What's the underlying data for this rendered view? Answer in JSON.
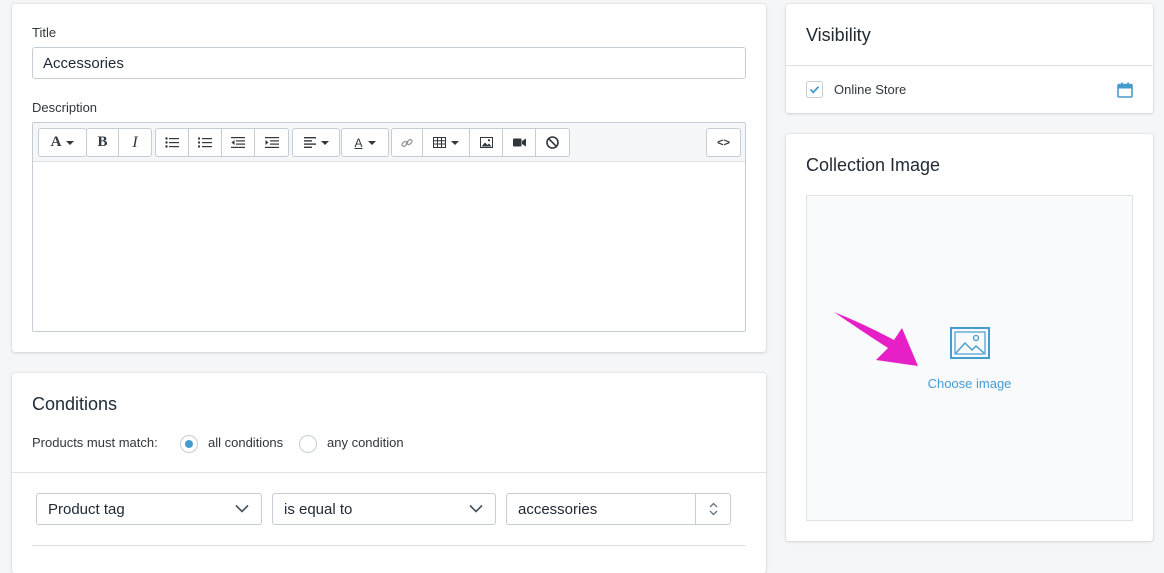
{
  "title_field": {
    "label": "Title",
    "value": "Accessories"
  },
  "description": {
    "label": "Description",
    "toolbar": [
      {
        "icon": "font-icon",
        "text": "A"
      },
      {
        "icon": "bold-icon",
        "text": "B"
      },
      {
        "icon": "italic-icon",
        "text": "I"
      },
      {
        "icon": "bulleted-list-icon"
      },
      {
        "icon": "numbered-list-icon"
      },
      {
        "icon": "outdent-icon"
      },
      {
        "icon": "indent-icon"
      },
      {
        "icon": "align-icon"
      },
      {
        "icon": "text-color-icon",
        "text": "A"
      },
      {
        "icon": "link-icon"
      },
      {
        "icon": "table-icon"
      },
      {
        "icon": "image-icon"
      },
      {
        "icon": "video-icon"
      },
      {
        "icon": "clear-format-icon"
      },
      {
        "icon": "code-icon",
        "text": "<>"
      }
    ]
  },
  "conditions": {
    "heading": "Conditions",
    "match_label": "Products must match:",
    "options": [
      "all conditions",
      "any condition"
    ],
    "selected": "all conditions",
    "rule": {
      "field": "Product tag",
      "operator": "is equal to",
      "value": "accessories"
    }
  },
  "visibility": {
    "heading": "Visibility",
    "channel": "Online Store",
    "checked": true
  },
  "collection_image": {
    "heading": "Collection Image",
    "choose_label": "Choose image"
  },
  "colors": {
    "accent": "#479ccf",
    "arrow": "#e61fc6",
    "background": "#f4f6f8"
  }
}
